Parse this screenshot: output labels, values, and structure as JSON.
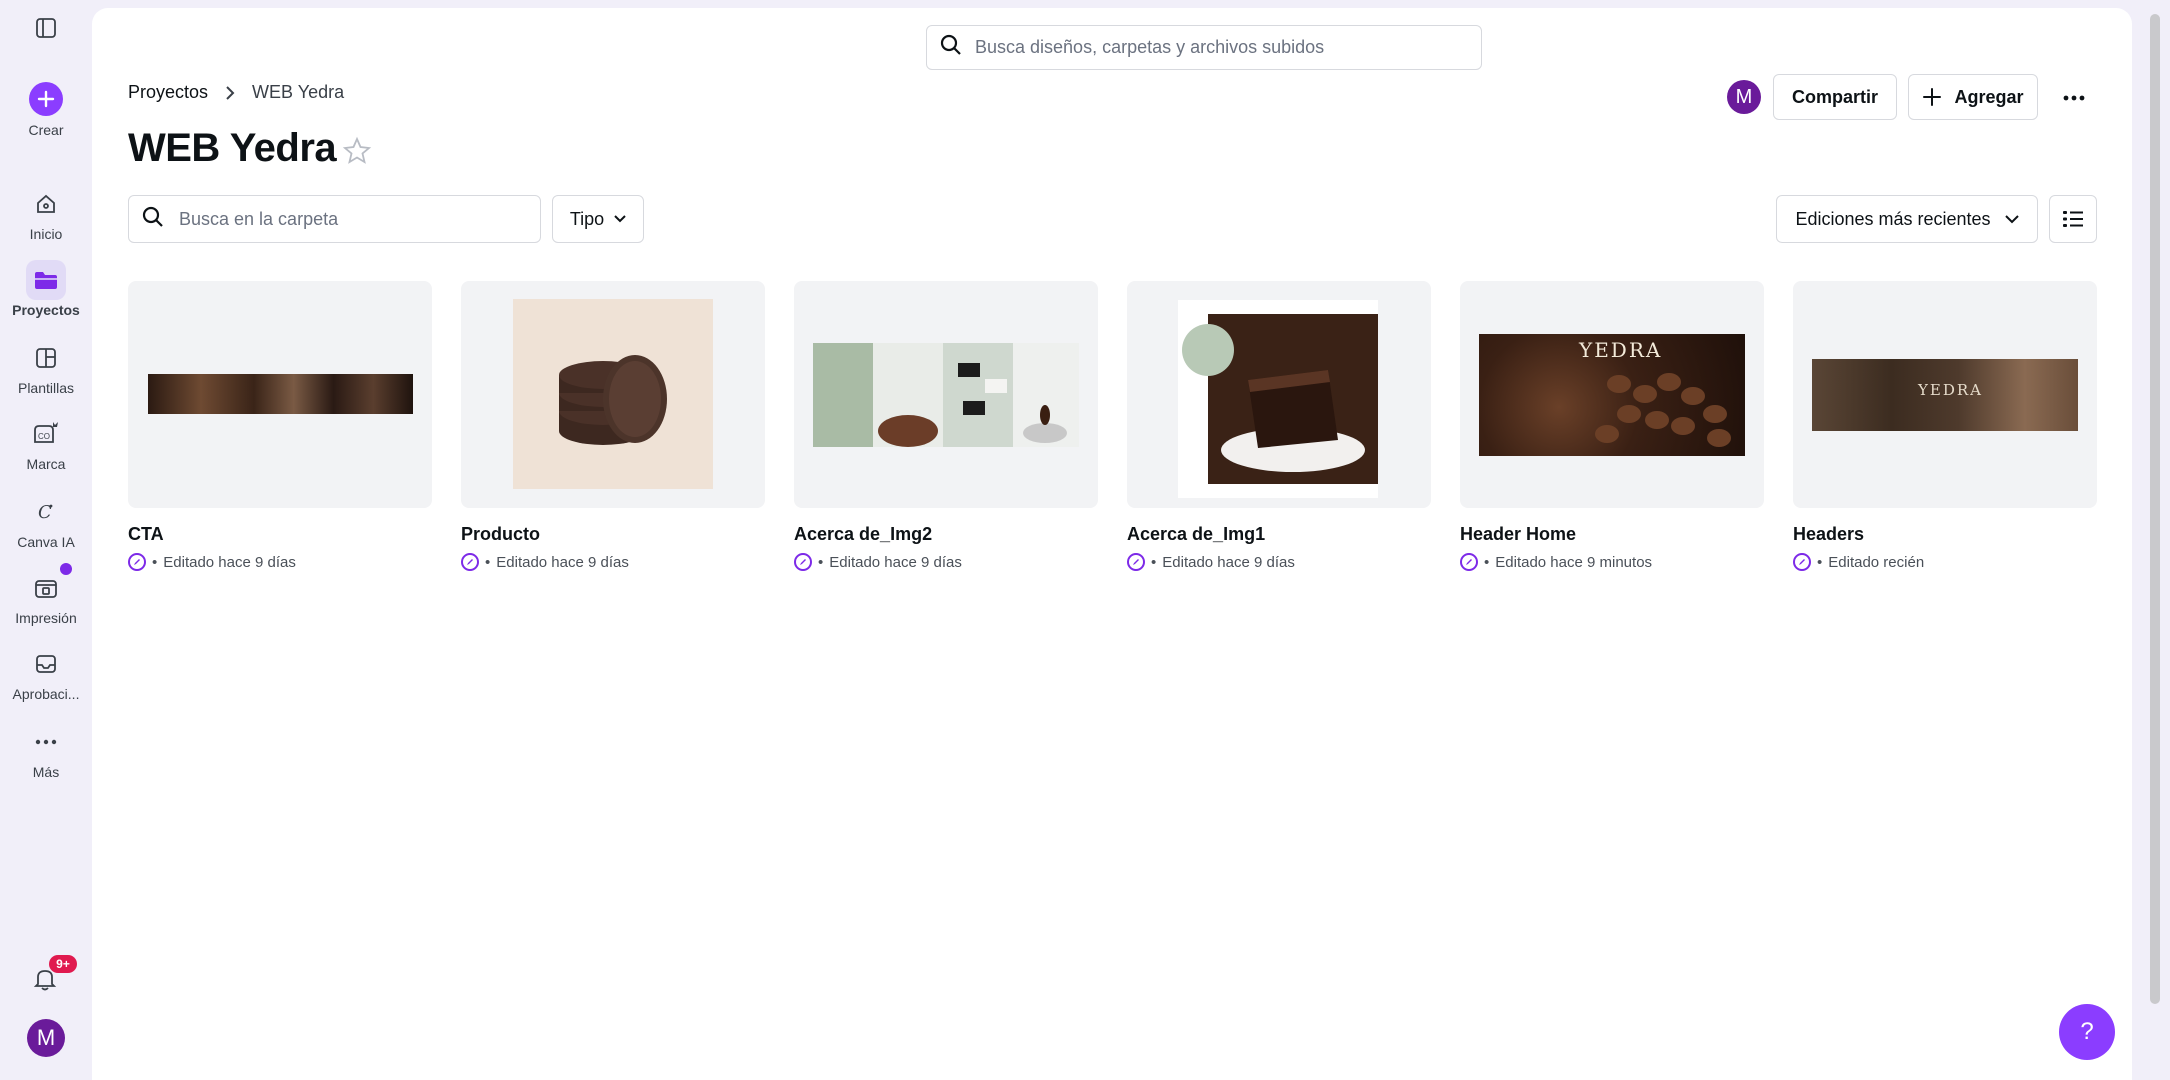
{
  "sidebar": {
    "items": [
      {
        "label": "Crear"
      },
      {
        "label": "Inicio"
      },
      {
        "label": "Proyectos"
      },
      {
        "label": "Plantillas"
      },
      {
        "label": "Marca"
      },
      {
        "label": "Canva IA"
      },
      {
        "label": "Impresión"
      },
      {
        "label": "Aprobaci..."
      },
      {
        "label": "Más"
      }
    ],
    "notifications_badge": "9+",
    "avatar_initial": "M"
  },
  "search": {
    "placeholder": "Busca diseños, carpetas y archivos subidos"
  },
  "breadcrumb": {
    "items": [
      "Proyectos",
      "WEB Yedra"
    ]
  },
  "header": {
    "title": "WEB Yedra",
    "avatar_initial": "M",
    "share_label": "Compartir",
    "add_label": "Agregar"
  },
  "filters": {
    "folder_search_placeholder": "Busca en la carpeta",
    "type_label": "Tipo",
    "sort_label": "Ediciones más recientes"
  },
  "designs": [
    {
      "title": "CTA",
      "meta": "Editado hace 9 días"
    },
    {
      "title": "Producto",
      "meta": "Editado hace 9 días"
    },
    {
      "title": "Acerca de_Img2",
      "meta": "Editado hace 9 días"
    },
    {
      "title": "Acerca de_Img1",
      "meta": "Editado hace 9 días"
    },
    {
      "title": "Header Home",
      "meta": "Editado hace 9 minutos"
    },
    {
      "title": "Headers",
      "meta": "Editado recién"
    }
  ],
  "thumb_text": {
    "header_home": "YEDRA",
    "headers": "YEDRA"
  },
  "help_label": "?",
  "colors": {
    "accent": "#8b3dff",
    "sidebar_bg": "#f1eff9",
    "badge": "#e01a4f"
  }
}
